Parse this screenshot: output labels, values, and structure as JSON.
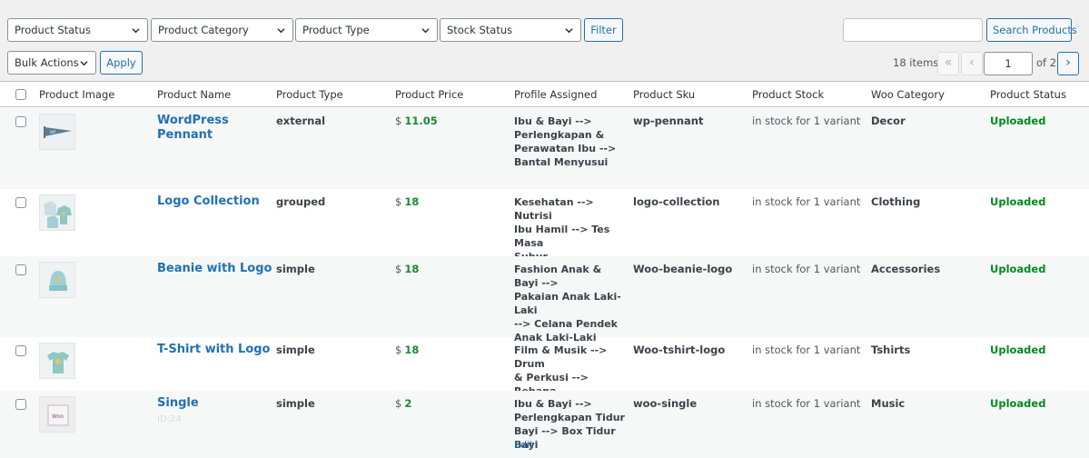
{
  "filters": {
    "product_status": "Product Status",
    "product_category": "Product Category",
    "product_type": "Product Type",
    "stock_status": "Stock Status",
    "filter_button": "Filter",
    "search_button": "Search Products",
    "search_value": ""
  },
  "bulk": {
    "action": "Bulk Actions",
    "apply_button": "Apply"
  },
  "pagination": {
    "items": "18 items",
    "first": "«",
    "prev": "‹",
    "current_page": "1",
    "of_text": "of 2",
    "next": "›"
  },
  "columns": [
    "Product Image",
    "Product Name",
    "Product Type",
    "Product Price",
    "Profile Assigned",
    "Product Sku",
    "Product Stock",
    "Woo Category",
    "Product Status"
  ],
  "rows": [
    {
      "thumb_icon": "pennant-icon",
      "name_line1": "WordPress",
      "name_line2": "Pennant",
      "type": "external",
      "currency": "$",
      "price": "11.05",
      "profile": [
        "Ibu & Bayi -->",
        "Perlengkapan &",
        "Perawatan Ibu -->",
        "Bantal Menyusui"
      ],
      "sku": "wp-pennant",
      "stock": "in stock for 1 variant",
      "category": "Decor",
      "status": "Uploaded"
    },
    {
      "thumb_icon": "hoodie-collection-icon",
      "name_line1": "Logo Collection",
      "type": "grouped",
      "currency": "$",
      "price": "18",
      "profile": [
        "Kesehatan --> Nutrisi",
        "Ibu Hamil --> Tes Masa",
        "Subur"
      ],
      "sku": "logo-collection",
      "stock": "in stock for 1 variant",
      "category": "Clothing",
      "status": "Uploaded"
    },
    {
      "thumb_icon": "beanie-icon",
      "name_line1": "Beanie with Logo",
      "type": "simple",
      "currency": "$",
      "price": "18",
      "profile": [
        "Fashion Anak & Bayi -->",
        "Pakaian Anak Laki-Laki",
        "--> Celana Pendek",
        "Anak Laki-Laki"
      ],
      "sku": "Woo-beanie-logo",
      "stock": "in stock for 1 variant",
      "category": "Accessories",
      "status": "Uploaded"
    },
    {
      "thumb_icon": "tshirt-icon",
      "name_line1": "T-Shirt with Logo",
      "type": "simple",
      "currency": "$",
      "price": "18",
      "profile": [
        "Film & Musik --> Drum",
        "& Perkusi --> Rebana"
      ],
      "sku": "Woo-tshirt-logo",
      "stock": "in stock for 1 variant",
      "category": "Tshirts",
      "status": "Uploaded"
    },
    {
      "thumb_icon": "album-icon",
      "name_line1": "Single",
      "id_text": "ID:24",
      "type": "simple",
      "currency": "$",
      "price": "2",
      "profile": [
        "Ibu & Bayi -->",
        "Perlengkapan Tidur",
        "Bayi --> Box Tidur Bayi"
      ],
      "edit_link": "Edit",
      "sku": "woo-single",
      "stock": "in stock for 1 variant",
      "category": "Music",
      "status": "Uploaded"
    }
  ],
  "colors": {
    "accent": "#2271b1",
    "status_uploaded": "#008a20",
    "price": "#1a8a34",
    "background": "#f0f0f1"
  }
}
